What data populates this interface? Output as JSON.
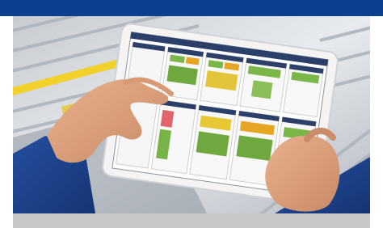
{
  "banner": {
    "color": "#0d3f8f"
  },
  "photo": {
    "subject": "hands-holding-tablet-dashboard",
    "background": "conveyor-rollers"
  },
  "footer": {
    "color": "#c8c8c8"
  }
}
